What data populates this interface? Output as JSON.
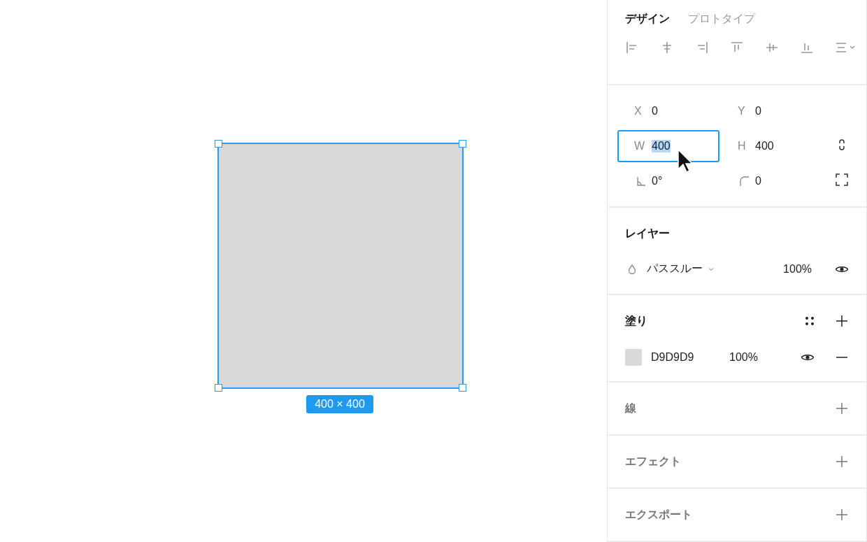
{
  "canvas": {
    "shape": {
      "selected": true
    },
    "size_label": "400 × 400"
  },
  "tabs": [
    {
      "label": "デザイン",
      "selected": true
    },
    {
      "label": "プロトタイプ",
      "selected": false
    }
  ],
  "properties": [
    [
      {
        "kind": "text",
        "label": "X",
        "value": "0",
        "focused": false
      },
      {
        "kind": "text",
        "label": "Y",
        "value": "0",
        "focused": false
      }
    ],
    [
      {
        "kind": "text",
        "label": "W",
        "value": "400",
        "focused": true
      },
      {
        "kind": "text",
        "label": "H",
        "value": "400",
        "focused": false
      },
      {
        "kind": "lock"
      }
    ],
    [
      {
        "kind": "rotation",
        "value": "0°",
        "focused": false
      },
      {
        "kind": "radius",
        "value": "0",
        "focused": false
      },
      {
        "kind": "corners"
      }
    ]
  ],
  "layer": {
    "title": "レイヤー",
    "blend": "パススルー",
    "opacity": "100%"
  },
  "fill": {
    "title": "塗り",
    "items": [
      {
        "hex": "D9D9D9",
        "color": "#d9d9d9",
        "opacity": "100%"
      }
    ]
  },
  "sections": [
    {
      "title": "線"
    },
    {
      "title": "エフェクト"
    },
    {
      "title": "エクスポート"
    }
  ]
}
